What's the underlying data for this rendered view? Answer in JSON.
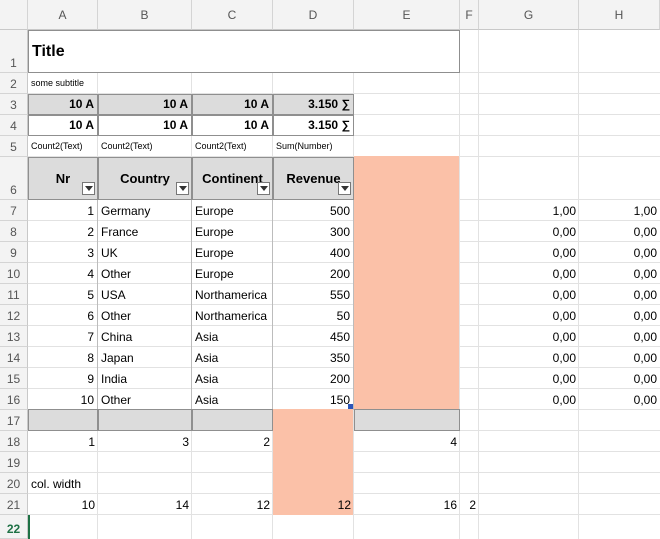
{
  "columns": [
    "A",
    "B",
    "C",
    "D",
    "E",
    "F",
    "G",
    "H"
  ],
  "rows": [
    "1",
    "2",
    "3",
    "4",
    "5",
    "6",
    "7",
    "8",
    "9",
    "10",
    "11",
    "12",
    "13",
    "14",
    "15",
    "16",
    "17",
    "18",
    "19",
    "20",
    "21",
    "22"
  ],
  "title": "Title",
  "subtitle": "some subtitle",
  "summary_rows": [
    [
      "10 A",
      "10 A",
      "10 A",
      "3.150 ∑"
    ],
    [
      "10 A",
      "10 A",
      "10 A",
      "3.150 ∑"
    ]
  ],
  "agg_labels": [
    "Count2(Text)",
    "Count2(Text)",
    "Count2(Text)",
    "Sum(Number)"
  ],
  "headers": [
    "Nr",
    "Country",
    "Continent",
    "Revenue"
  ],
  "table": [
    {
      "nr": "1",
      "country": "Germany",
      "continent": "Europe",
      "revenue": "500",
      "g": "1,00",
      "h": "1,00"
    },
    {
      "nr": "2",
      "country": "France",
      "continent": "Europe",
      "revenue": "300",
      "g": "0,00",
      "h": "0,00"
    },
    {
      "nr": "3",
      "country": "UK",
      "continent": "Europe",
      "revenue": "400",
      "g": "0,00",
      "h": "0,00"
    },
    {
      "nr": "4",
      "country": "Other",
      "continent": "Europe",
      "revenue": "200",
      "g": "0,00",
      "h": "0,00"
    },
    {
      "nr": "5",
      "country": "USA",
      "continent": "Northamerica",
      "revenue": "550",
      "g": "0,00",
      "h": "0,00"
    },
    {
      "nr": "6",
      "country": "Other",
      "continent": "Northamerica",
      "revenue": "50",
      "g": "0,00",
      "h": "0,00"
    },
    {
      "nr": "7",
      "country": "China",
      "continent": "Asia",
      "revenue": "450",
      "g": "0,00",
      "h": "0,00"
    },
    {
      "nr": "8",
      "country": "Japan",
      "continent": "Asia",
      "revenue": "350",
      "g": "0,00",
      "h": "0,00"
    },
    {
      "nr": "9",
      "country": "India",
      "continent": "Asia",
      "revenue": "200",
      "g": "0,00",
      "h": "0,00"
    },
    {
      "nr": "10",
      "country": "Other",
      "continent": "Asia",
      "revenue": "150",
      "g": "0,00",
      "h": "0,00"
    }
  ],
  "row18": [
    "1",
    "3",
    "2",
    "4"
  ],
  "col_width_label": "col. width",
  "row21": [
    "10",
    "14",
    "12",
    "12",
    "16",
    "2"
  ],
  "colors": {
    "salmon": "#fbc1a8",
    "grey": "#dcdcdc",
    "selected_row": "#1e7145"
  }
}
